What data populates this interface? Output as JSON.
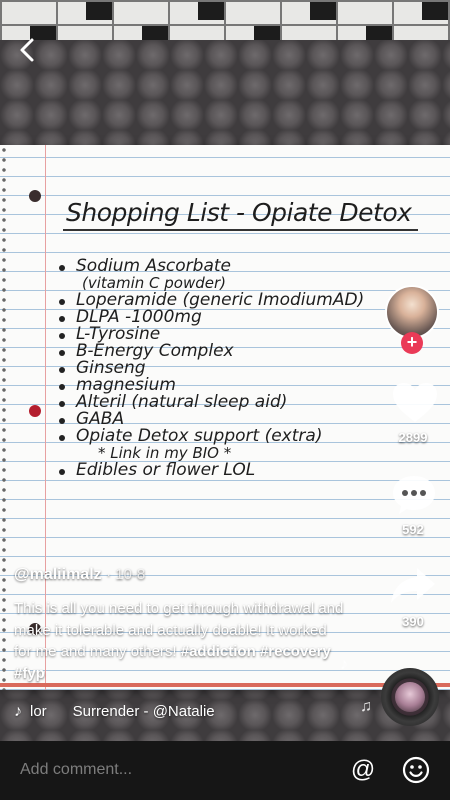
{
  "video": {
    "title": "Shopping List - Opiate Detox",
    "items": [
      {
        "text": "Sodium Ascorbate",
        "sub": "(vitamin C powder)"
      },
      {
        "text": "Loperamide (generic ImodiumAD)"
      },
      {
        "text": "DLPA -1000mg"
      },
      {
        "text": "L-Tyrosine"
      },
      {
        "text": "B-Energy Complex"
      },
      {
        "text": "Ginseng"
      },
      {
        "text": "magnesium"
      },
      {
        "text": "Alteril (natural sleep aid)"
      },
      {
        "text": "GABA"
      },
      {
        "text": "Opiate Detox support (extra)",
        "sub": "* Link in my BIO *"
      },
      {
        "text": "Edibles or flower LOL"
      }
    ]
  },
  "rail": {
    "follow_symbol": "+",
    "likes": "2899",
    "comments": "592",
    "shares": "390"
  },
  "post": {
    "username": "@maliimalz",
    "date": "· 10-8",
    "caption": "This is all you need to get through withdrawal and make it tolerable and actually doable! It worked for me and many others!",
    "hashtags": [
      "#addiction",
      "#recovery",
      "#fyp"
    ],
    "music_prefix": "lor",
    "music_title": "Surrender - @Natalie"
  },
  "comment_bar": {
    "placeholder": "Add comment...",
    "at_symbol": "@"
  },
  "icons": {
    "back": "chevron-left-icon",
    "like": "heart-icon",
    "comment": "speech-bubble-icon",
    "share": "share-arrow-icon",
    "music": "music-note-icon",
    "emoji": "smiley-icon",
    "mention": "at-icon"
  },
  "colors": {
    "follow_badge": "#ea3a57",
    "comment_bar_bg": "#161616",
    "placeholder": "#7d7d7d"
  }
}
